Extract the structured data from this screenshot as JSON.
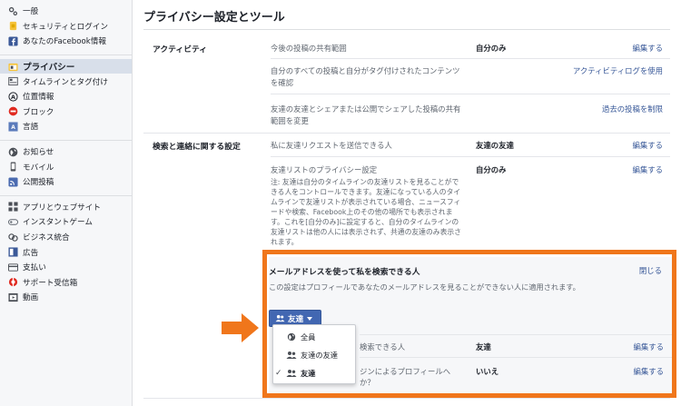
{
  "colors": {
    "accent": "#4267b2",
    "link": "#385898",
    "highlight": "#f0761b"
  },
  "sidebar": {
    "groups": [
      [
        {
          "label": "一般",
          "icon": "gear-icon"
        },
        {
          "label": "セキュリティとログイン",
          "icon": "shield-icon"
        },
        {
          "label": "あなたのFacebook情報",
          "icon": "facebook-icon"
        }
      ],
      [
        {
          "label": "プライバシー",
          "icon": "lock-icon",
          "active": true
        },
        {
          "label": "タイムラインとタグ付け",
          "icon": "timeline-icon"
        },
        {
          "label": "位置情報",
          "icon": "location-icon"
        },
        {
          "label": "ブロック",
          "icon": "block-icon"
        },
        {
          "label": "言語",
          "icon": "language-icon"
        }
      ],
      [
        {
          "label": "お知らせ",
          "icon": "globe-icon"
        },
        {
          "label": "モバイル",
          "icon": "mobile-icon"
        },
        {
          "label": "公開投稿",
          "icon": "rss-icon"
        }
      ],
      [
        {
          "label": "アプリとウェブサイト",
          "icon": "apps-icon"
        },
        {
          "label": "インスタントゲーム",
          "icon": "gamepad-icon"
        },
        {
          "label": "ビジネス統合",
          "icon": "business-icon"
        },
        {
          "label": "広告",
          "icon": "ads-icon"
        },
        {
          "label": "支払い",
          "icon": "card-icon"
        },
        {
          "label": "サポート受信箱",
          "icon": "lifebuoy-icon"
        },
        {
          "label": "動画",
          "icon": "video-icon"
        }
      ]
    ]
  },
  "main": {
    "title": "プライバシー設定とツール",
    "sections": {
      "activity": {
        "title": "アクティビティ",
        "rows": [
          {
            "label": "今後の投稿の共有範囲",
            "value": "自分のみ",
            "link": "編集する"
          },
          {
            "label": "自分のすべての投稿と自分がタグ付けされたコンテンツを確認",
            "value": "",
            "link": "アクティビティログを使用"
          },
          {
            "label": "友達の友達とシェアまたは公開でシェアした投稿の共有範囲を変更",
            "value": "",
            "link": "過去の投稿を制限"
          }
        ]
      },
      "search": {
        "title": "検索と連絡に関する設定",
        "rows": [
          {
            "label": "私に友達リクエストを送信できる人",
            "value": "友達の友達",
            "link": "編集する"
          },
          {
            "label": "友達リストのプライバシー設定",
            "value": "自分のみ",
            "link": "編集する",
            "note": "注: 友達は自分のタイムラインの友達リストを見ることができる人をコントロールできます。友達になっている人のタイムラインで友達リストが表示されている場合、ニュースフィードや検索、Facebook上のその他の場所でも表示されます。これを[自分のみ]に設定すると、自分のタイムラインの友達リストは他の人には表示されず、共通の友達のみ表示されます。"
          }
        ]
      },
      "expanded": {
        "title": "メールアドレスを使って私を検索できる人",
        "close": "閉じる",
        "description": "この設定はプロフィールであなたのメールアドレスを見ることができない人に適用されます。",
        "selected": "友達",
        "options": [
          {
            "label": "全員",
            "icon": "globe-icon",
            "checked": false
          },
          {
            "label": "友達の友達",
            "icon": "friends-icon",
            "checked": false
          },
          {
            "label": "友達",
            "icon": "friends-icon",
            "checked": true
          }
        ]
      },
      "below_rows": [
        {
          "label_tail": "検索できる人",
          "value": "友達",
          "link": "編集する"
        },
        {
          "label_tail": "ジンによるプロフィールへ",
          "label_tail2": "か？",
          "value": "いいえ",
          "link": "編集する"
        }
      ]
    }
  }
}
